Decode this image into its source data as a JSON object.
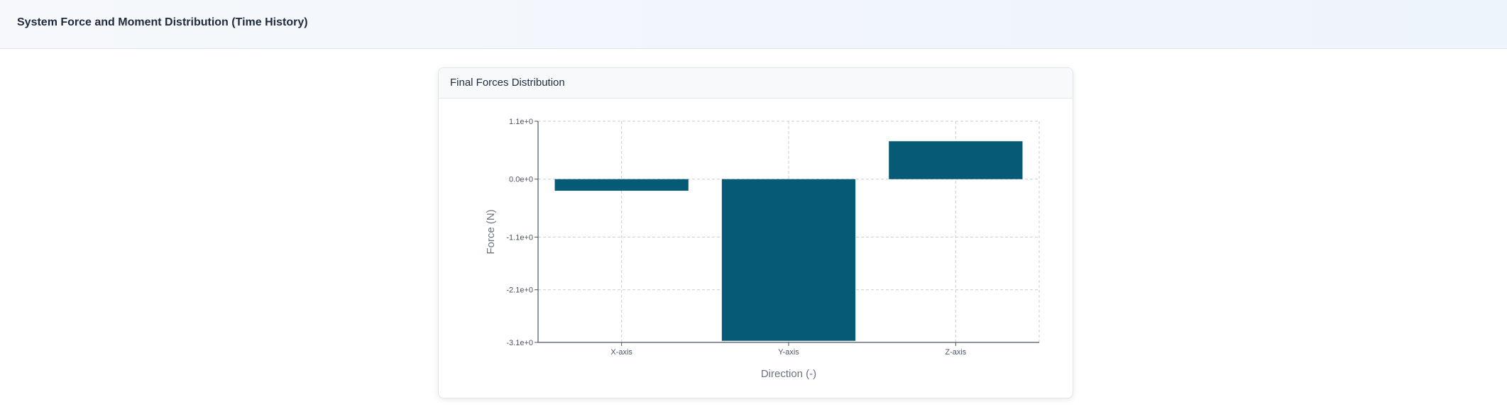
{
  "header": {
    "title": "System Force and Moment Distribution (Time History)"
  },
  "card": {
    "title": "Final Forces Distribution"
  },
  "colors": {
    "bar": "#075a75",
    "grid": "#c9ced6",
    "axis": "#4b5563"
  },
  "chart_data": {
    "type": "bar",
    "title": "",
    "xlabel": "Direction (-)",
    "ylabel": "Force (N)",
    "categories": [
      "X-axis",
      "Y-axis",
      "Z-axis"
    ],
    "values": [
      -0.22,
      -3.07,
      0.72
    ],
    "ylim": [
      -3.1,
      1.1
    ],
    "yticks": [
      1.1,
      0.0,
      -1.1,
      -2.1,
      -3.1
    ],
    "ytick_labels": [
      "1.1e+0",
      "0.0e+0",
      "-1.1e+0",
      "-2.1e+0",
      "-3.1e+0"
    ],
    "grid": true,
    "legend": "none"
  }
}
